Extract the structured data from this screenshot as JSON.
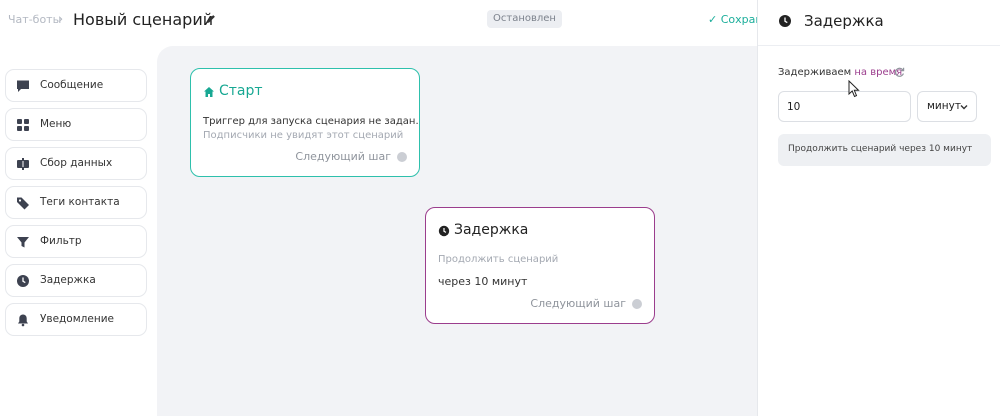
{
  "header": {
    "breadcrumb": "Чат-боты",
    "breadcrumb_sep": "›",
    "title": "Новый сценарий",
    "status": "Остановлен",
    "save_label": "✓  Сохран"
  },
  "sidebar": {
    "items": [
      {
        "label": "Сообщение",
        "icon": "message-icon"
      },
      {
        "label": "Меню",
        "icon": "grid-icon"
      },
      {
        "label": "Сбор данных",
        "icon": "data-collect-icon"
      },
      {
        "label": "Теги контакта",
        "icon": "tag-icon"
      },
      {
        "label": "Фильтр",
        "icon": "filter-icon"
      },
      {
        "label": "Задержка",
        "icon": "clock-icon"
      },
      {
        "label": "Уведомление",
        "icon": "bell-icon"
      }
    ]
  },
  "nodes": {
    "start": {
      "title": "Старт",
      "line1": "Триггер для запуска сценария не задан.",
      "line2": "Подписчики не увидят этот сценарий",
      "next": "Следующий шаг"
    },
    "delay": {
      "title": "Задержка",
      "subtitle": "Продолжить сценарий",
      "value": "через 10 минут",
      "next": "Следующий шаг"
    }
  },
  "panel": {
    "title": "Задержка",
    "label_prefix": "Задерживаем",
    "label_link": "на время",
    "input_value": "10",
    "unit": "минут",
    "info": "Продолжить сценарий через 10 минут"
  },
  "colors": {
    "accent_teal": "#2ec0ac",
    "accent_purple": "#9b3d8d",
    "canvas_bg": "#f2f3f6"
  }
}
